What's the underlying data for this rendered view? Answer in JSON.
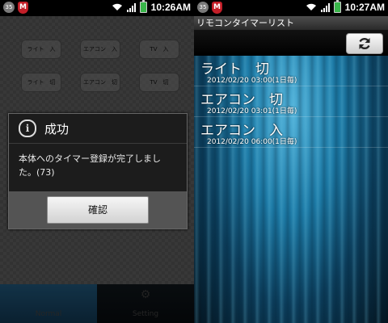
{
  "left_screen": {
    "status_bar": {
      "time": "10:26AM",
      "app_icon": "35",
      "shield_icon": "M"
    },
    "remote_buttons": [
      {
        "label": "ライト　入"
      },
      {
        "label": "エアコン　入"
      },
      {
        "label": "TV　入"
      },
      {
        "label": "ライト　切"
      },
      {
        "label": "エアコン　切"
      },
      {
        "label": "TV　切"
      }
    ],
    "dialog": {
      "title": "成功",
      "info_icon": "i",
      "message": "本体へのタイマー登録が完了しました。(73)",
      "confirm_label": "確認"
    },
    "tabs": {
      "normal": "Normal",
      "setting": "Setting"
    }
  },
  "right_screen": {
    "status_bar": {
      "time": "10:27AM",
      "app_icon": "35",
      "shield_icon": "M"
    },
    "title": "リモコンタイマーリスト",
    "timers": [
      {
        "name": "ライト　切",
        "time": "2012/02/20 03:00(1日毎)"
      },
      {
        "name": "エアコン　切",
        "time": "2012/02/20 03:01(1日毎)"
      },
      {
        "name": "エアコン　入",
        "time": "2012/02/20 06:00(1日毎)"
      }
    ]
  },
  "colors": {
    "tab_normal": "#1d4e6e",
    "battery": "#39b54a",
    "shield": "#c31e28",
    "list_accent": "#1c7aa6"
  }
}
